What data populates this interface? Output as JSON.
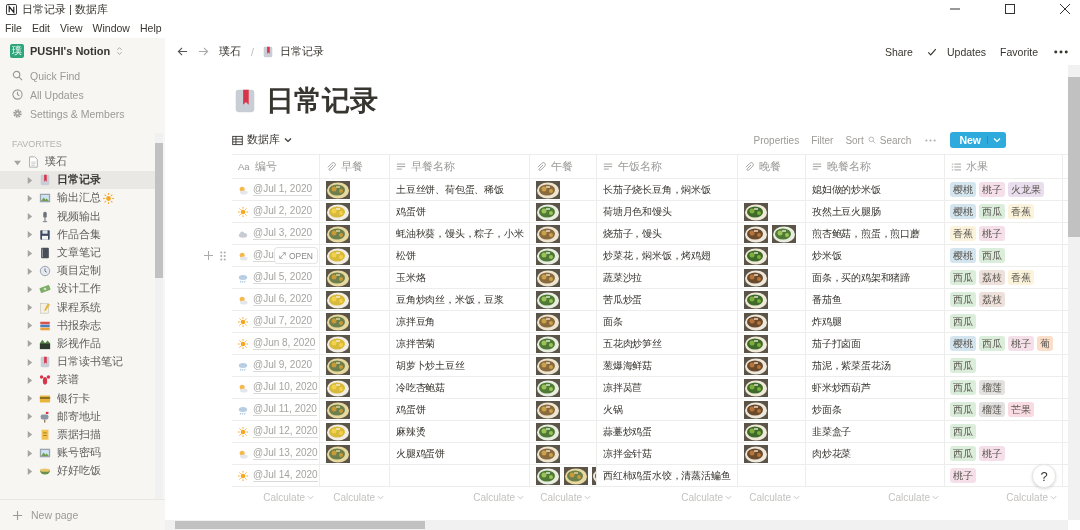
{
  "window": {
    "title": "日常记录 | 数据库"
  },
  "menu": [
    "File",
    "Edit",
    "View",
    "Window",
    "Help"
  ],
  "sidebar": {
    "workspace": "PUSHI's Notion",
    "workspace_initial": "璞",
    "actions": [
      "Quick Find",
      "All Updates",
      "Settings & Members"
    ],
    "section": "FAVORITES",
    "tree": [
      {
        "label": "璞石",
        "expanded": true,
        "selected": false,
        "children": [
          {
            "label": "日常记录",
            "expanded": false,
            "selected": true
          },
          {
            "label": "输出汇总",
            "expanded": false,
            "selected": false
          },
          {
            "label": "视频输出",
            "expanded": false,
            "selected": false
          },
          {
            "label": "作品合集",
            "expanded": false,
            "selected": false
          },
          {
            "label": "文章笔记",
            "expanded": false,
            "selected": false
          },
          {
            "label": "项目定制",
            "expanded": false,
            "selected": false
          },
          {
            "label": "设计工作",
            "expanded": false,
            "selected": false
          },
          {
            "label": "课程系统",
            "expanded": false,
            "selected": false
          },
          {
            "label": "书报杂志",
            "expanded": false,
            "selected": false
          },
          {
            "label": "影视作品",
            "expanded": false,
            "selected": false
          },
          {
            "label": "日常读书笔记",
            "expanded": false,
            "selected": false
          },
          {
            "label": "菜谱",
            "expanded": false,
            "selected": false
          },
          {
            "label": "银行卡",
            "expanded": false,
            "selected": false
          },
          {
            "label": "邮寄地址",
            "expanded": false,
            "selected": false
          },
          {
            "label": "票据扫描",
            "expanded": false,
            "selected": false
          },
          {
            "label": "账号密码",
            "expanded": false,
            "selected": false
          },
          {
            "label": "好好吃饭",
            "expanded": false,
            "selected": false
          }
        ]
      }
    ],
    "new_page": "New page"
  },
  "topbar": {
    "breadcrumb": [
      "璞石",
      "日常记录"
    ],
    "breadcrumb_separator": "/",
    "actions": [
      "Share",
      "Updates",
      "Favorite"
    ]
  },
  "page": {
    "title": "日常记录"
  },
  "database": {
    "view": "数据库",
    "toolbar": [
      "Properties",
      "Filter",
      "Sort",
      "Search"
    ],
    "new_button": "New",
    "columns": [
      {
        "name": "编号",
        "kind": "title",
        "glyph": "Aa"
      },
      {
        "name": "早餐",
        "kind": "file"
      },
      {
        "name": "早餐名称",
        "kind": "text"
      },
      {
        "name": "午餐",
        "kind": "file"
      },
      {
        "name": "午饭名称",
        "kind": "text"
      },
      {
        "name": "晚餐",
        "kind": "file"
      },
      {
        "name": "晚餐名称",
        "kind": "text"
      },
      {
        "name": "水果",
        "kind": "multi_select"
      }
    ],
    "rows": [
      {
        "date": "@Jul 1, 2020",
        "breakfast": [
          {
            "kind": "picture"
          }
        ],
        "breakfast_name": "土豆丝饼、荷包蛋、稀饭",
        "lunch": [
          {
            "kind": "picture"
          }
        ],
        "lunch_name": "长茄子烧长豆角，焖米饭",
        "dinner_name": "媳妇做的炒米饭",
        "fruits": [
          {
            "label": "樱桃",
            "color": "#d3e5ef"
          },
          {
            "label": "桃子",
            "color": "#f5e0e9"
          },
          {
            "label": "火龙果",
            "color": "#e8deee"
          }
        ]
      },
      {
        "date": "@Jul 2, 2020",
        "breakfast": [
          {
            "kind": "picture"
          }
        ],
        "breakfast_name": "鸡蛋饼",
        "lunch": [
          {
            "kind": "picture"
          }
        ],
        "lunch_name": "荷塘月色和馒头",
        "dinner": [
          {
            "kind": "picture"
          }
        ],
        "dinner_name": "孜然土豆火腿肠",
        "fruits": [
          {
            "label": "樱桃",
            "color": "#d3e5ef"
          },
          {
            "label": "西瓜",
            "color": "#dbeddb"
          },
          {
            "label": "香蕉",
            "color": "#fbf3db"
          }
        ]
      },
      {
        "date": "@Jul 3, 2020",
        "breakfast": [
          {
            "kind": "picture"
          }
        ],
        "breakfast_name": "蚝油秋葵，馒头，粽子，小米",
        "lunch": [
          {
            "kind": "picture"
          }
        ],
        "lunch_name": "烧茄子，馒头",
        "dinner": [
          {
            "kind": "picture"
          },
          {
            "kind": "picture"
          }
        ],
        "dinner_name": "煎杏鲍菇，煎蛋，煎口蘑",
        "fruits": [
          {
            "label": "香蕉",
            "color": "#fbf3db"
          },
          {
            "label": "桃子",
            "color": "#f5e0e9"
          }
        ]
      },
      {
        "date": "@Ju",
        "open": "OPEN",
        "breakfast": [
          {
            "kind": "picture"
          }
        ],
        "breakfast_name": "松饼",
        "lunch": [
          {
            "kind": "picture"
          }
        ],
        "lunch_name": "炒菜花，焖米饭，烤鸡翅",
        "dinner": [
          {
            "kind": "picture"
          }
        ],
        "dinner_name": "炒米饭",
        "fruits": [
          {
            "label": "樱桃",
            "color": "#d3e5ef"
          },
          {
            "label": "西瓜",
            "color": "#dbeddb"
          }
        ]
      },
      {
        "date": "@Jul 5, 2020",
        "breakfast": [
          {
            "kind": "picture"
          }
        ],
        "breakfast_name": "玉米烙",
        "lunch": [
          {
            "kind": "picture"
          }
        ],
        "lunch_name": "蔬菜沙拉",
        "dinner": [
          {
            "kind": "picture"
          }
        ],
        "dinner_name": "面条，买的鸡架和猪蹄",
        "fruits": [
          {
            "label": "西瓜",
            "color": "#dbeddb"
          },
          {
            "label": "荔枝",
            "color": "#eee0da"
          },
          {
            "label": "香蕉",
            "color": "#fbf3db"
          }
        ]
      },
      {
        "date": "@Jul 6, 2020",
        "breakfast": [
          {
            "kind": "picture"
          }
        ],
        "breakfast_name": "豆角炒肉丝，米饭，豆浆",
        "lunch": [
          {
            "kind": "picture"
          }
        ],
        "lunch_name": "苦瓜炒蛋",
        "dinner": [
          {
            "kind": "picture"
          }
        ],
        "dinner_name": "番茄鱼",
        "fruits": [
          {
            "label": "西瓜",
            "color": "#dbeddb"
          },
          {
            "label": "荔枝",
            "color": "#eee0da"
          }
        ]
      },
      {
        "date": "@Jul 7, 2020",
        "breakfast": [
          {
            "kind": "picture"
          }
        ],
        "breakfast_name": "凉拌豆角",
        "lunch": [
          {
            "kind": "picture"
          }
        ],
        "lunch_name": "面条",
        "dinner": [
          {
            "kind": "picture"
          }
        ],
        "dinner_name": "炸鸡腿",
        "fruits": [
          {
            "label": "西瓜",
            "color": "#dbeddb"
          }
        ]
      },
      {
        "date": "@Jun 8, 2020",
        "breakfast": [
          {
            "kind": "picture"
          }
        ],
        "breakfast_name": "凉拌苦菊",
        "lunch": [
          {
            "kind": "picture"
          }
        ],
        "lunch_name": "五花肉炒笋丝",
        "dinner": [
          {
            "kind": "picture"
          }
        ],
        "dinner_name": "茄子打卤面",
        "fruits": [
          {
            "label": "樱桃",
            "color": "#d3e5ef"
          },
          {
            "label": "西瓜",
            "color": "#dbeddb"
          },
          {
            "label": "桃子",
            "color": "#f5e0e9"
          },
          {
            "label": "葡",
            "color": "#fadec9"
          }
        ]
      },
      {
        "date": "@Jul 9, 2020",
        "breakfast": [
          {
            "kind": "picture"
          }
        ],
        "breakfast_name": "胡萝卜炒土豆丝",
        "lunch": [
          {
            "kind": "picture"
          }
        ],
        "lunch_name": "葱爆海鲜菇",
        "dinner": [
          {
            "kind": "picture"
          }
        ],
        "dinner_name": "茄泥，紫菜蛋花汤",
        "fruits": [
          {
            "label": "西瓜",
            "color": "#dbeddb"
          }
        ]
      },
      {
        "date": "@Jul 10, 2020",
        "breakfast": [
          {
            "kind": "picture"
          }
        ],
        "breakfast_name": "冷吃杏鲍菇",
        "lunch": [
          {
            "kind": "picture"
          }
        ],
        "lunch_name": "凉拌莴苣",
        "dinner": [
          {
            "kind": "picture"
          }
        ],
        "dinner_name": "虾米炒西葫芦",
        "fruits": [
          {
            "label": "西瓜",
            "color": "#dbeddb"
          },
          {
            "label": "榴莲",
            "color": "#e3e2e0"
          }
        ]
      },
      {
        "date": "@Jul 11, 2020",
        "breakfast": [
          {
            "kind": "picture"
          }
        ],
        "breakfast_name": "鸡蛋饼",
        "lunch": [
          {
            "kind": "picture"
          }
        ],
        "lunch_name": "火锅",
        "dinner": [
          {
            "kind": "picture"
          }
        ],
        "dinner_name": "炒面条",
        "fruits": [
          {
            "label": "西瓜",
            "color": "#dbeddb"
          },
          {
            "label": "榴莲",
            "color": "#e3e2e0"
          },
          {
            "label": "芒果",
            "color": "#f9dbe3"
          }
        ]
      },
      {
        "date": "@Jul 12, 2020",
        "breakfast": [
          {
            "kind": "picture"
          }
        ],
        "breakfast_name": "麻辣烫",
        "lunch": [
          {
            "kind": "picture"
          }
        ],
        "lunch_name": "蒜薹炒鸡蛋",
        "dinner": [
          {
            "kind": "picture"
          }
        ],
        "dinner_name": "韭菜盒子",
        "fruits": [
          {
            "label": "西瓜",
            "color": "#dbeddb"
          }
        ]
      },
      {
        "date": "@Jul 13, 2020",
        "breakfast": [
          {
            "kind": "picture"
          }
        ],
        "breakfast_name": "火腿鸡蛋饼",
        "lunch": [
          {
            "kind": "picture"
          }
        ],
        "lunch_name": "凉拌金针菇",
        "dinner": [
          {
            "kind": "picture"
          }
        ],
        "dinner_name": "肉炒花菜",
        "fruits": [
          {
            "label": "西瓜",
            "color": "#dbeddb"
          },
          {
            "label": "桃子",
            "color": "#f5e0e9"
          }
        ]
      },
      {
        "date": "@Jul 14, 2020",
        "lunch": [
          {
            "kind": "picture"
          },
          {
            "kind": "picture"
          },
          {
            "kind": "picture"
          }
        ],
        "lunch_name": "西红柿鸡蛋水饺，清蒸活鳊鱼",
        "fruits": [
          {
            "label": "桃子",
            "color": "#f5e0e9"
          }
        ]
      }
    ],
    "footer": [
      "Calculate",
      "Calculate",
      "Calculate",
      "Calculate",
      "Calculate",
      "Calculate",
      "Calculate",
      "Calculate"
    ]
  },
  "help": "?"
}
